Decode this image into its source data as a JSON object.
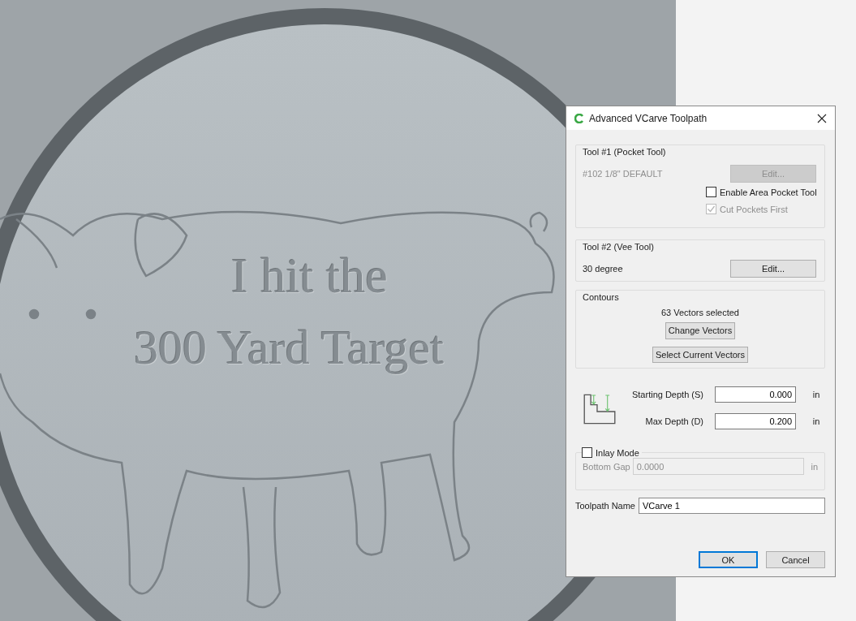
{
  "canvas": {
    "carved_text": [
      "I hit the",
      "300 Yard Target"
    ]
  },
  "dialog": {
    "title": "Advanced VCarve Toolpath",
    "tool_1": {
      "label": "Tool #1 (Pocket Tool)",
      "tool_name": "#102 1/8\" DEFAULT",
      "edit_button": {
        "label": "Edit...",
        "disabled": true
      },
      "options": [
        {
          "label": "Enable Area Pocket Tool",
          "checked": false,
          "disabled": false
        },
        {
          "label": "Cut Pockets First",
          "checked": true,
          "disabled": true
        }
      ]
    },
    "tool_2": {
      "label": "Tool #2 (Vee Tool)",
      "tool_name": "30 degree",
      "edit_button": {
        "label": "Edit...",
        "disabled": false
      }
    },
    "contours": {
      "label": "Contours",
      "status": "63 Vectors selected",
      "buttons": [
        "Change Vectors",
        "Select Current Vectors"
      ]
    },
    "depths": [
      {
        "label": "Starting Depth (S)",
        "value": "0.000",
        "unit": "in"
      },
      {
        "label": "Max Depth (D)",
        "value": "0.200",
        "unit": "in"
      }
    ],
    "inlay": {
      "label": "Inlay Mode",
      "checked": false,
      "bottom_gap": {
        "label": "Bottom Gap",
        "value": "0.0000",
        "unit": "in",
        "disabled": true
      }
    },
    "toolpath_name": {
      "label": "Toolpath Name",
      "value": "VCarve 1"
    },
    "buttons": [
      {
        "label": "OK",
        "selected": true
      },
      {
        "label": "Cancel",
        "selected": false
      }
    ]
  }
}
